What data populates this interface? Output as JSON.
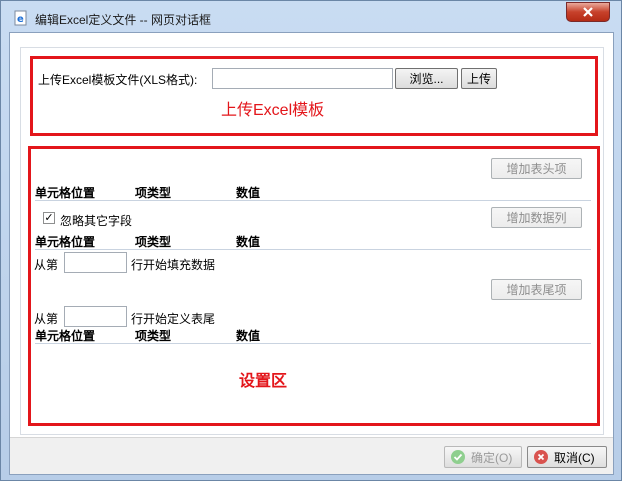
{
  "window": {
    "title": "编辑Excel定义文件 -- 网页对话框"
  },
  "upload": {
    "label": "上传Excel模板文件(XLS格式):",
    "file_value": "",
    "browse_label": "浏览...",
    "upload_label": "上传",
    "note": "上传Excel模板"
  },
  "settings": {
    "add_header_label": "增加表头项",
    "headers": {
      "cell": "单元格位置",
      "type": "项类型",
      "value": "数值"
    },
    "ignore_checked": true,
    "ignore_label": "忽略其它字段",
    "add_column_label": "增加数据列",
    "fill_prefix": "从第",
    "fill_suffix": "行开始填充数据",
    "add_footer_label": "增加表尾项",
    "footer_prefix": "从第",
    "footer_suffix": "行开始定义表尾",
    "note": "设置区"
  },
  "footer": {
    "ok_label": "确定(O)",
    "cancel_label": "取消(C)"
  }
}
